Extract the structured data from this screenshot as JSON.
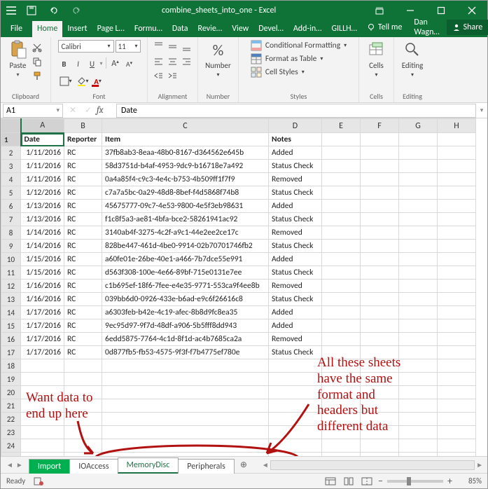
{
  "title": "combine_sheets_into_one - Excel",
  "user_name": "Dan Wagn…",
  "share_label": "Share",
  "tell_me": "Tell me",
  "ribbon_tabs": [
    "File",
    "Home",
    "Insert",
    "Page L…",
    "Formu…",
    "Data",
    "Revie…",
    "View",
    "Devel…",
    "Add-in…",
    "GILLH…"
  ],
  "active_tab": 1,
  "groups": {
    "clipboard": "Clipboard",
    "font": "Font",
    "alignment": "Alignment",
    "number": "Number",
    "styles": "Styles",
    "cells": "Cells",
    "editing": "Editing"
  },
  "ribbon": {
    "paste": "Paste",
    "font_name": "Calibri",
    "font_size": "11",
    "number_label": "Number",
    "cond_fmt": "Conditional Formatting",
    "fmt_table": "Format as Table",
    "cell_styles": "Cell Styles",
    "cells": "Cells",
    "editing": "Editing"
  },
  "namebox": "A1",
  "formula": "Date",
  "columns": [
    "A",
    "B",
    "C",
    "D",
    "E",
    "F",
    "G",
    "H"
  ],
  "colWidths": [
    "colA",
    "colB",
    "colC",
    "colD",
    "colE",
    "colF",
    "colG",
    "colH"
  ],
  "header_row": [
    "Date",
    "Reporter",
    "Item",
    "Notes",
    "",
    "",
    "",
    ""
  ],
  "rows": [
    [
      "1/11/2016",
      "RC",
      "37fb8ab3-8eaa-48b0-8167-d364562e645b",
      "Added"
    ],
    [
      "1/11/2016",
      "RC",
      "58d3751d-b4af-4953-9dc9-b16718e7a492",
      "Status Check"
    ],
    [
      "1/11/2016",
      "RC",
      "0a4a85f4-c9c3-4e4c-b753-4b509ff1f7f9",
      "Removed"
    ],
    [
      "1/12/2016",
      "RC",
      "c7a7a5bc-0a29-48d8-8bef-f4d5868f74b8",
      "Status Check"
    ],
    [
      "1/13/2016",
      "RC",
      "45675777-09c7-4e53-9800-4e5f3eb98631",
      "Added"
    ],
    [
      "1/13/2016",
      "RC",
      "f1c8f5a3-ae81-4bfa-bce2-58261941ac92",
      "Status Check"
    ],
    [
      "1/14/2016",
      "RC",
      "3140ab4f-3275-4c2f-a9c1-44e2ee2ce17c",
      "Removed"
    ],
    [
      "1/14/2016",
      "RC",
      "828be447-461d-4be0-9914-02b70701746fb2",
      "Status Check"
    ],
    [
      "1/15/2016",
      "RC",
      "a60fe01e-26be-40e1-a466-7b7dce55e991",
      "Added"
    ],
    [
      "1/15/2016",
      "RC",
      "d563f308-100e-4e66-89bf-715e0131e7ee",
      "Status Check"
    ],
    [
      "1/16/2016",
      "RC",
      "c1b695ef-18f6-7fee-e4e35-9771-553ca9f4ee8b",
      "Removed"
    ],
    [
      "1/16/2016",
      "RC",
      "039bb6d0-0926-433e-b6ad-e9c6f26616c8",
      "Status Check"
    ],
    [
      "1/17/2016",
      "RC",
      "a6303feb-b42e-4c19-afec-8b8d9fc8ea35",
      "Added"
    ],
    [
      "1/17/2016",
      "RC",
      "9ec95d97-9f7d-48df-a906-5b5fff8dd943",
      "Added"
    ],
    [
      "1/17/2016",
      "RC",
      "6edd5875-7764-4c1d-8f1d-ac4b7685ca2a",
      "Removed"
    ],
    [
      "1/17/2016",
      "RC",
      "0d877fb5-fb53-4575-9f3f-f7b4775ef780e",
      "Status Check"
    ]
  ],
  "blank_rows": 8,
  "sheet_tabs": [
    "Import",
    "IOAccess",
    "MemoryDisc",
    "Peripherals"
  ],
  "active_sheet": 2,
  "status_text": "Ready",
  "zoom": "85%",
  "annotations": {
    "left": "Want data to\nend up here",
    "right": "All these sheets\nhave the same\nformat and\nheaders but\ndifferent data"
  }
}
